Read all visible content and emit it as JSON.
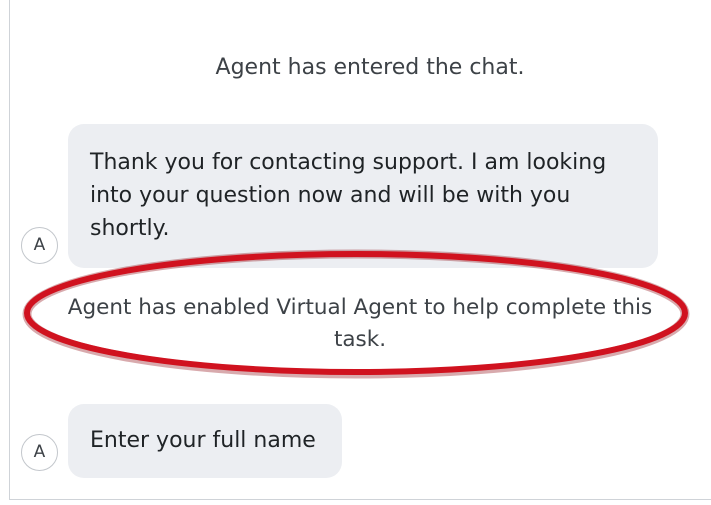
{
  "chat": {
    "system_entered": "Agent has entered the chat.",
    "agent_message_1": "Thank you for contacting support. I am looking into your question now and will be with you shortly.",
    "system_enabled": "Agent has enabled Virtual Agent to help complete this task.",
    "agent_message_2": "Enter your full name",
    "avatar_initial": "A"
  },
  "highlight": {
    "color": "#d0121f",
    "target": "system_enabled"
  }
}
